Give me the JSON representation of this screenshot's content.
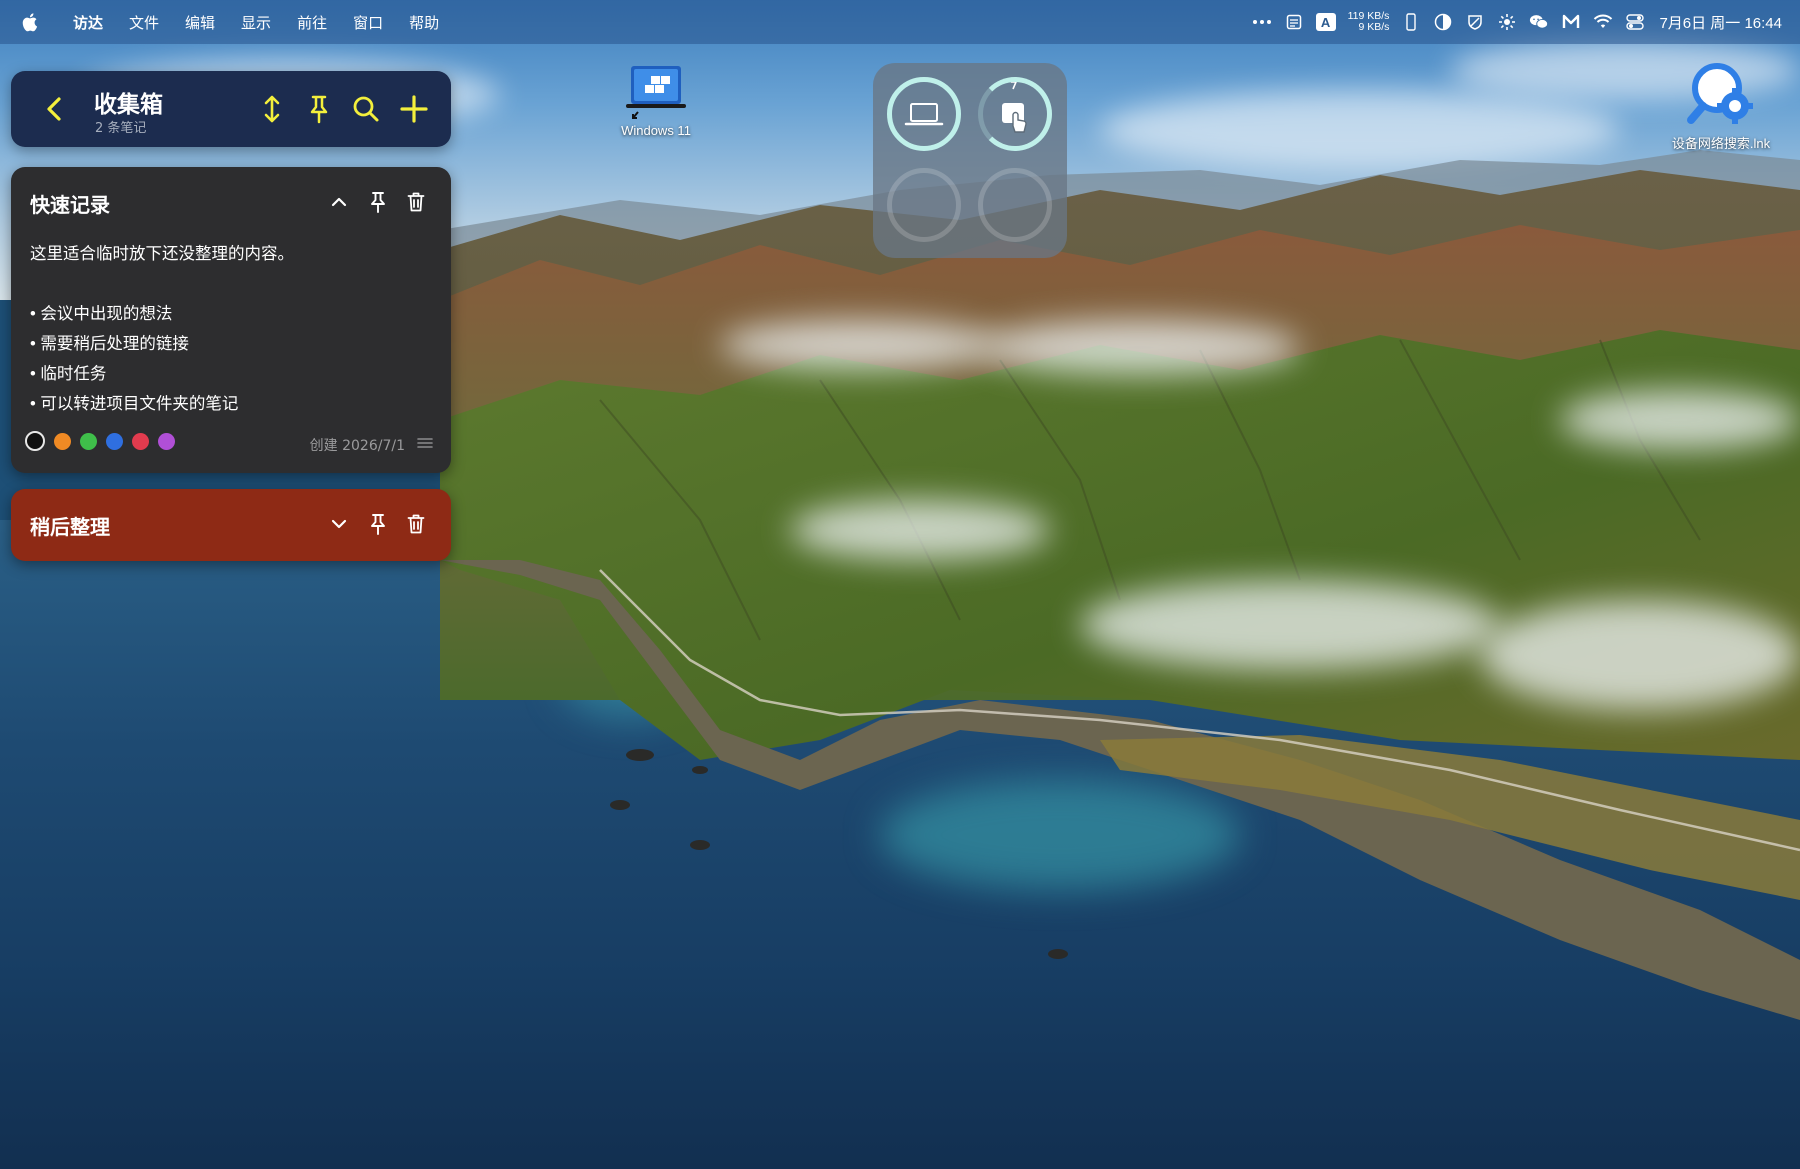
{
  "menubar": {
    "app_name": "访达",
    "items": [
      "文件",
      "编辑",
      "显示",
      "前往",
      "窗口",
      "帮助"
    ],
    "net_up": "119 KB/s",
    "net_down": "9 KB/s",
    "input_method": "A",
    "datetime": "7月6日 周一 16:44"
  },
  "notes": {
    "title": "收集箱",
    "subtitle": "2 条笔记",
    "accent_color": "#f3ef3c",
    "cards": [
      {
        "title": "快速记录",
        "lead": "这里适合临时放下还没整理的内容。",
        "bullets": [
          "会议中出现的想法",
          "需要稍后处理的链接",
          "临时任务",
          "可以转进项目文件夹的笔记"
        ],
        "created": "创建 2026/7/1",
        "color": "#2d2d2f",
        "palette": [
          "#111111",
          "#f08a24",
          "#3fbf4a",
          "#2f6fe0",
          "#e23b4e",
          "#b04fd6"
        ]
      },
      {
        "title": "稍后整理",
        "color": "#8e2a15"
      }
    ]
  },
  "desktop": {
    "windows_label": "Windows 11",
    "network_search_label": "设备网络搜索.lnk"
  }
}
